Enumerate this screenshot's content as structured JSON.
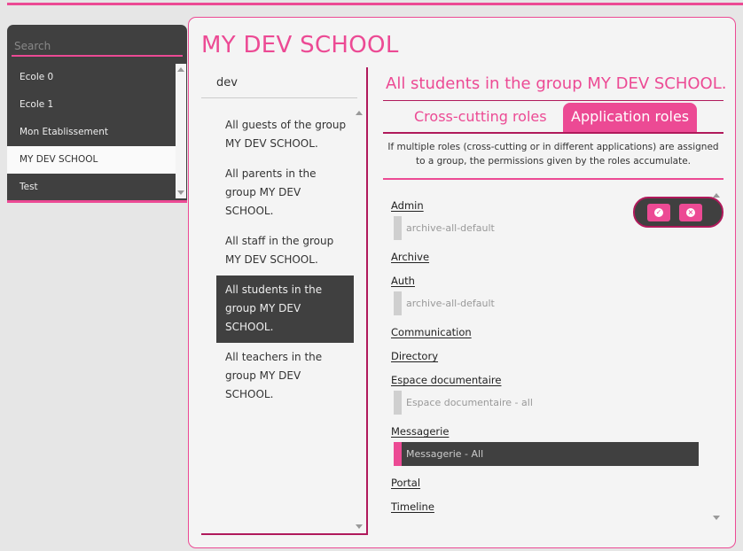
{
  "schools": {
    "search_placeholder": "Search",
    "items": [
      "Ecole 0",
      "Ecole 1",
      "Mon Etablissement",
      "MY DEV SCHOOL",
      "Test"
    ]
  },
  "main": {
    "title": "MY DEV SCHOOL",
    "group_filter": "dev",
    "groups": [
      "All guests of the group MY DEV SCHOOL.",
      "All parents in the group MY DEV SCHOOL.",
      "All staff in the group MY DEV SCHOOL.",
      "All students in the group MY DEV SCHOOL.",
      "All teachers in the group MY DEV SCHOOL."
    ],
    "selected_group_heading": "All students in the group MY DEV SCHOOL.",
    "tabs": {
      "cross": "Cross-cutting roles",
      "app": "Application roles"
    },
    "info": "If multiple roles (cross-cutting or in different applications) are assigned to a group, the permissions given by the roles accumulate.",
    "apps": {
      "admin": "Admin",
      "admin_role": "archive-all-default",
      "archive": "Archive",
      "auth": "Auth",
      "auth_role": "archive-all-default",
      "communication": "Communication",
      "directory": "Directory",
      "espace": "Espace documentaire",
      "espace_role": "Espace documentaire - all",
      "messagerie": "Messagerie",
      "messagerie_role": "Messagerie - All",
      "portal": "Portal",
      "timeline": "Timeline"
    },
    "actions": {
      "ok_icon": "check-circle-icon",
      "cancel_icon": "close-circle-icon"
    }
  },
  "colors": {
    "accent": "#ec4a94",
    "dark": "#404040",
    "accent_dark": "#b0195b"
  }
}
